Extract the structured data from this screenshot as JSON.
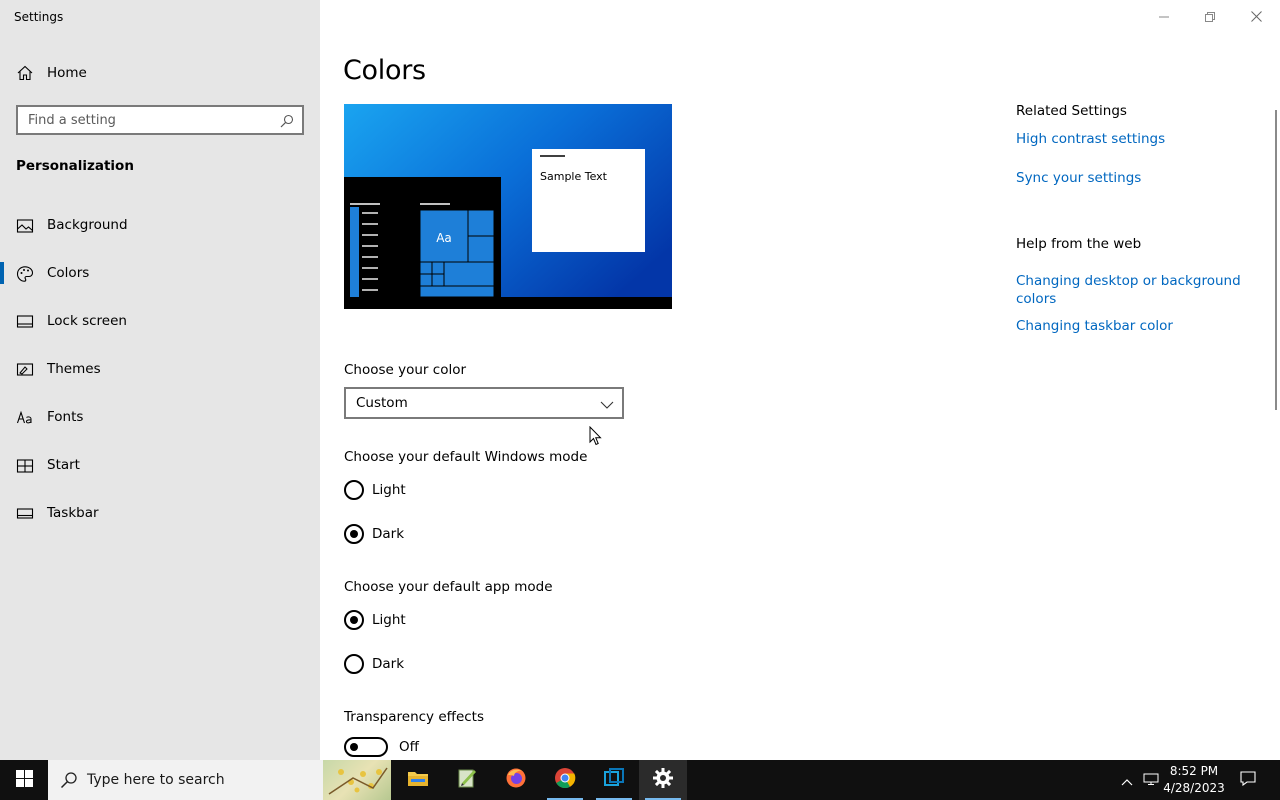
{
  "window": {
    "title": "Settings"
  },
  "sidebar": {
    "home_label": "Home",
    "search_placeholder": "Find a setting",
    "section_title": "Personalization",
    "items": [
      {
        "label": "Background",
        "icon": "picture-icon"
      },
      {
        "label": "Colors",
        "icon": "palette-icon",
        "active": true
      },
      {
        "label": "Lock screen",
        "icon": "lock-screen-icon"
      },
      {
        "label": "Themes",
        "icon": "brush-icon"
      },
      {
        "label": "Fonts",
        "icon": "font-icon"
      },
      {
        "label": "Start",
        "icon": "start-tiles-icon"
      },
      {
        "label": "Taskbar",
        "icon": "taskbar-icon"
      }
    ]
  },
  "main": {
    "title": "Colors",
    "preview": {
      "sample_text": "Sample Text",
      "tile_text": "Aa"
    },
    "choose_color": {
      "label": "Choose your color",
      "selected": "Custom"
    },
    "windows_mode": {
      "label": "Choose your default Windows mode",
      "options": [
        {
          "label": "Light",
          "checked": false
        },
        {
          "label": "Dark",
          "checked": true
        }
      ]
    },
    "app_mode": {
      "label": "Choose your default app mode",
      "options": [
        {
          "label": "Light",
          "checked": true
        },
        {
          "label": "Dark",
          "checked": false
        }
      ]
    },
    "transparency": {
      "label": "Transparency effects",
      "state": "Off"
    }
  },
  "related": {
    "related_title": "Related Settings",
    "related_links": [
      "High contrast settings",
      "Sync your settings"
    ],
    "help_title": "Help from the web",
    "help_links": [
      "Changing desktop or background colors",
      "Changing taskbar color"
    ]
  },
  "taskbar": {
    "search_text": "Type here to search",
    "apps": [
      "file-explorer-icon",
      "notepad-pp-icon",
      "firefox-icon",
      "chrome-icon",
      "virtualbox-icon",
      "settings-gear-icon"
    ],
    "time": "8:52 PM",
    "date": "4/28/2023"
  },
  "colors": {
    "accent": "#0078d7",
    "link": "#0067c0",
    "sidebar_bg": "#e6e6e6",
    "taskbar_bg": "#101010"
  }
}
